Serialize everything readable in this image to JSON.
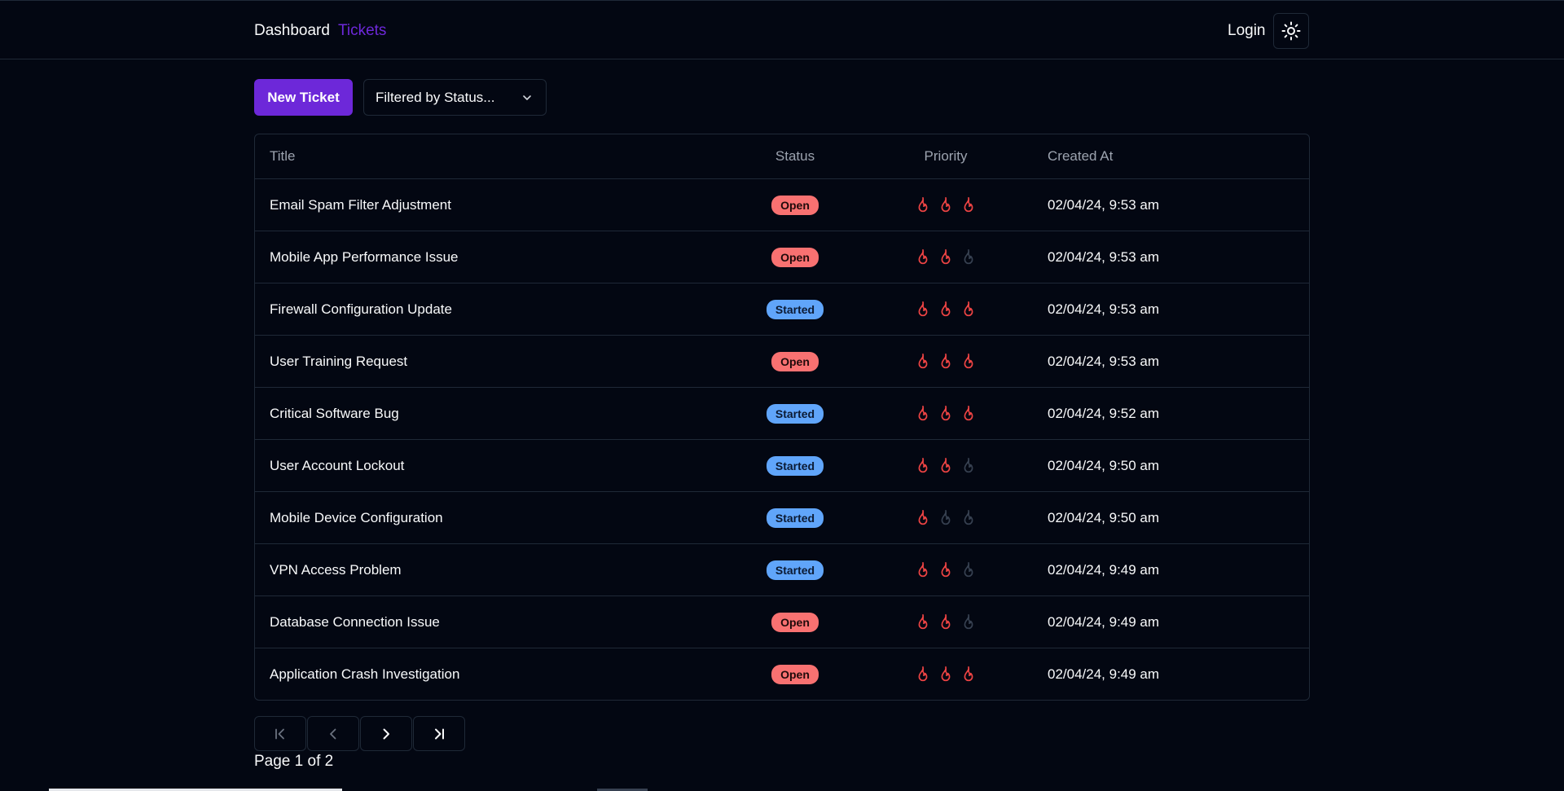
{
  "nav": {
    "dashboard": "Dashboard",
    "tickets": "Tickets",
    "login": "Login",
    "theme_icon": "sun-icon"
  },
  "toolbar": {
    "new_ticket": "New Ticket",
    "filter": "Filtered by Status..."
  },
  "table": {
    "headers": {
      "title": "Title",
      "status": "Status",
      "priority": "Priority",
      "created": "Created At"
    },
    "rows": [
      {
        "title": "Email Spam Filter Adjustment",
        "status": "Open",
        "priority": 3,
        "created": "02/04/24, 9:53 am"
      },
      {
        "title": "Mobile App Performance Issue",
        "status": "Open",
        "priority": 2,
        "created": "02/04/24, 9:53 am"
      },
      {
        "title": "Firewall Configuration Update",
        "status": "Started",
        "priority": 3,
        "created": "02/04/24, 9:53 am"
      },
      {
        "title": "User Training Request",
        "status": "Open",
        "priority": 3,
        "created": "02/04/24, 9:53 am"
      },
      {
        "title": "Critical Software Bug",
        "status": "Started",
        "priority": 3,
        "created": "02/04/24, 9:52 am"
      },
      {
        "title": "User Account Lockout",
        "status": "Started",
        "priority": 2,
        "created": "02/04/24, 9:50 am"
      },
      {
        "title": "Mobile Device Configuration",
        "status": "Started",
        "priority": 1,
        "created": "02/04/24, 9:50 am"
      },
      {
        "title": "VPN Access Problem",
        "status": "Started",
        "priority": 2,
        "created": "02/04/24, 9:49 am"
      },
      {
        "title": "Database Connection Issue",
        "status": "Open",
        "priority": 2,
        "created": "02/04/24, 9:49 am"
      },
      {
        "title": "Application Crash Investigation",
        "status": "Open",
        "priority": 3,
        "created": "02/04/24, 9:49 am"
      }
    ]
  },
  "pagination": {
    "info": "Page 1 of 2"
  },
  "colors": {
    "accent": "#6d28d9",
    "open": "#f87171",
    "started": "#60a5fa",
    "flame_on": "#ef4444",
    "flame_off": "#374151"
  }
}
